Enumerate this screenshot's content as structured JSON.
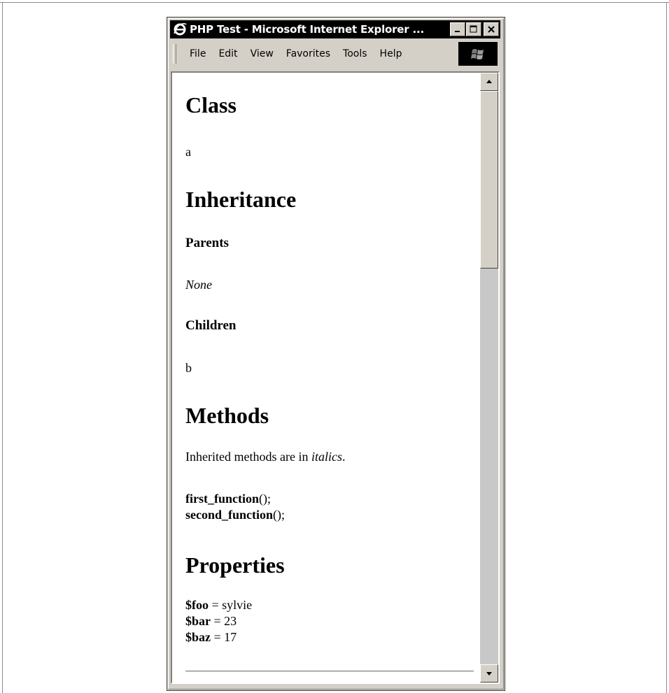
{
  "window": {
    "title": "PHP Test - Microsoft Internet Explorer ...",
    "menu": [
      "File",
      "Edit",
      "View",
      "Favorites",
      "Tools",
      "Help"
    ]
  },
  "page": {
    "class_heading": "Class",
    "class_name": "a",
    "inheritance_heading": "Inheritance",
    "parents_heading": "Parents",
    "parents_value": "None",
    "children_heading": "Children",
    "children_value": "b",
    "methods_heading": "Methods",
    "methods_note_prefix": "Inherited methods are in ",
    "methods_note_em": "italics",
    "methods_note_suffix": ".",
    "methods": [
      {
        "name": "first_function",
        "suffix": "();"
      },
      {
        "name": "second_function",
        "suffix": "();"
      }
    ],
    "properties_heading": "Properties",
    "properties": [
      {
        "name": "$foo",
        "sep": " = ",
        "value": "sylvie"
      },
      {
        "name": "$bar",
        "sep": " = ",
        "value": "23"
      },
      {
        "name": "$baz",
        "sep": " = ",
        "value": "17"
      }
    ]
  }
}
